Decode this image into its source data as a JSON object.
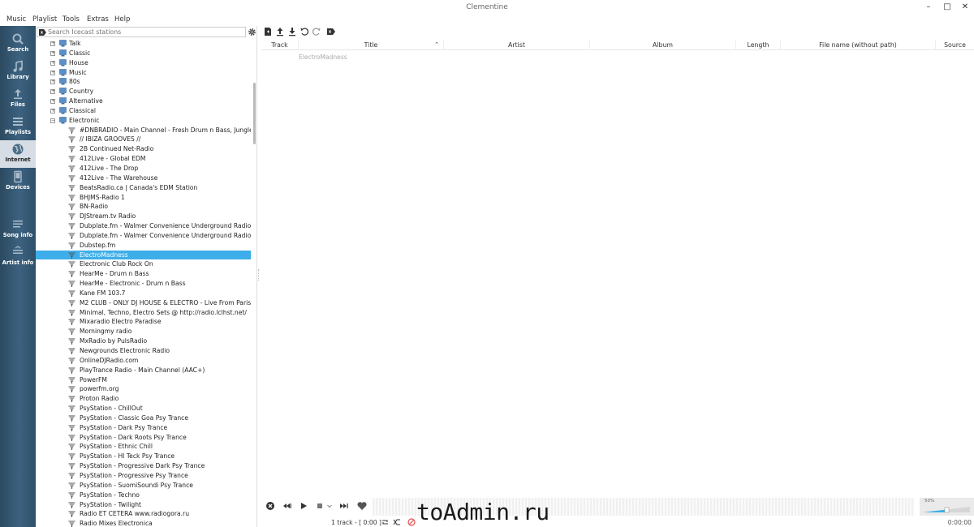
{
  "window": {
    "title": "Clementine",
    "minimize": "–",
    "maximize": "□",
    "close": "✕"
  },
  "menu": [
    "Music",
    "Playlist",
    "Tools",
    "Extras",
    "Help"
  ],
  "sidebar": [
    {
      "label": "Search",
      "icon": "search-icon"
    },
    {
      "label": "Library",
      "icon": "music-note-icon"
    },
    {
      "label": "Files",
      "icon": "upload-icon"
    },
    {
      "label": "Playlists",
      "icon": "list-icon"
    },
    {
      "label": "Internet",
      "icon": "globe-icon"
    },
    {
      "label": "Devices",
      "icon": "device-icon"
    },
    {
      "label": "Song info",
      "icon": "song-info-icon"
    },
    {
      "label": "Artist info",
      "icon": "artist-icon"
    }
  ],
  "search": {
    "placeholder": "Search Icecast stations"
  },
  "folders": [
    "Talk",
    "Classic",
    "House",
    "Music",
    "80s",
    "Country",
    "Alternative",
    "Classical",
    "Electronic"
  ],
  "stations": [
    "#DNBRADIO - Main Channel - Fresh Drum n Bass, Jungle",
    "// IBIZA GROOVES //",
    "2B Continued Net-Radio",
    "412Live - Global EDM",
    "412Live - The Drop",
    "412Live - The Warehouse",
    "BeatsRadio.ca |  Canada's EDM Station",
    "BHJMS-Radio 1",
    "BN-Radio",
    "DJStream.tv Radio",
    "Dubplate.fm - Walmer Convenience Underground Radio ...",
    "Dubplate.fm - Walmer Convenience Underground Radio ...",
    "Dubstep.fm",
    "ElectroMadness",
    "Electronic Club Rock On",
    "HearMe - Drum n Bass",
    "HearMe - Electronic - Drum n Bass",
    "Kane FM 103.7",
    "M2 CLUB - ONLY DJ HOUSE & ELECTRO - Live From Paris ...",
    "Minimal, Techno, Electro Sets @ http://radio.lclhst.net/",
    "Mixaradio Electro Paradise",
    "Morningmy radio",
    "MxRadio by PulsRadio",
    "Newgrounds Electronic Radio",
    "OnlineDJRadio.com",
    "PlayTrance Radio - Main Channel (AAC+)",
    "PowerFM",
    "powerfm.org",
    "Proton Radio",
    "PsyStation - ChillOut",
    "PsyStation - Classic Goa Psy Trance",
    "PsyStation - Dark Psy Trance",
    "PsyStation - Dark Roots Psy Trance",
    "PsyStation - Ethnic Chill",
    "PsyStation - HI Teck Psy Trance",
    "PsyStation - Progressive Dark Psy Trance",
    "PsyStation - Progressive Psy Trance",
    "PsyStation - SuomiSoundi Psy Trance",
    "PsyStation - Techno",
    "PsyStation - Twilight",
    "Radio ET CETERA www.radiogora.ru",
    "Radio Mixes Electronica"
  ],
  "selected_station": "ElectroMadness",
  "columns": [
    "Track",
    "Title",
    "Artist",
    "Album",
    "Length",
    "File name (without path)",
    "Source"
  ],
  "playlist": [
    {
      "title": "ElectroMadness"
    }
  ],
  "player": {
    "volume": "50%",
    "status": "1 track - [ 0:00 ]",
    "time": "0:00:00"
  },
  "watermark": "toAdmin.ru",
  "colors": {
    "selection": "#3daee9",
    "sidebar": "#3c6280",
    "stop": "#e05050"
  }
}
